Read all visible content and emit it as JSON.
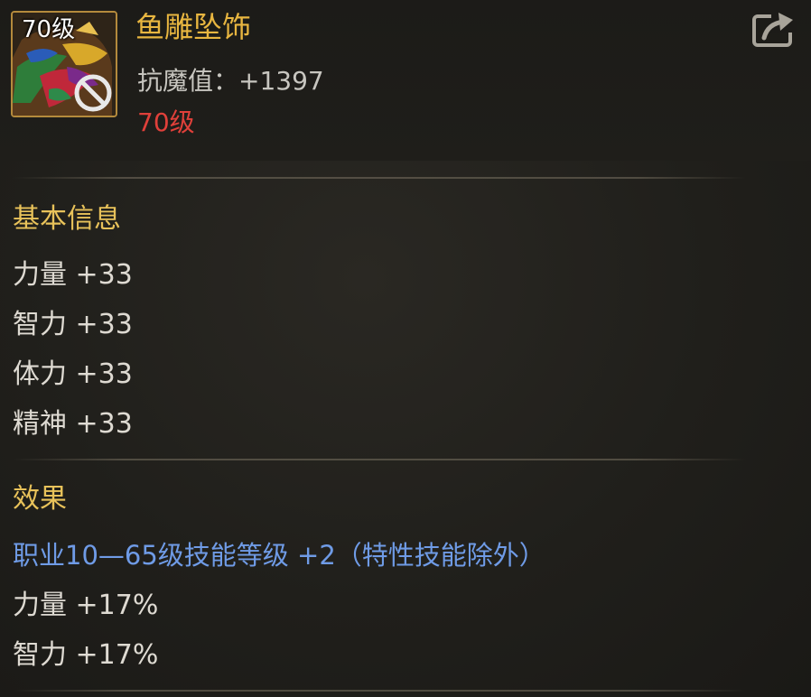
{
  "item": {
    "level_badge": "70级",
    "name": "鱼雕坠饰",
    "magic_resist": "抗魔值：+1397",
    "required_level": "70级",
    "icon": "fish-carving-pendant-icon",
    "restricted_icon": "prohibited-icon"
  },
  "header_actions": {
    "share_icon": "share-icon"
  },
  "basic_info": {
    "title": "基本信息",
    "stats": [
      "力量 +33",
      "智力 +33",
      "体力 +33",
      "精神 +33"
    ]
  },
  "effects": {
    "title": "效果",
    "skill_bonus": "职业10—65级技能等级 +2（特性技能除外）",
    "stats": [
      "力量 +17%",
      "智力 +17%"
    ]
  },
  "colors": {
    "item_name": "#e8b640",
    "section_title": "#e8c25a",
    "required_level": "#e0403a",
    "skill_bonus": "#6f9be6",
    "icon_border": "#b48a3c"
  }
}
